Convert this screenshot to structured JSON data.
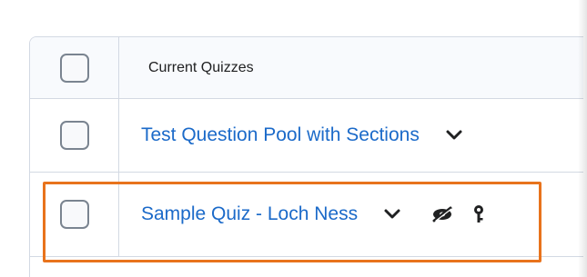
{
  "header": {
    "column_label": "Current Quizzes"
  },
  "quizzes": [
    {
      "title": "Test Question Pool with Sections",
      "status_icons": []
    },
    {
      "title": "Sample Quiz - Loch Ness",
      "status_icons": [
        "hidden-eye-icon",
        "restricted-key-icon"
      ]
    }
  ],
  "colors": {
    "link": "#1b6ac9",
    "highlight": "#e8731c",
    "border": "#d3d9e3"
  }
}
